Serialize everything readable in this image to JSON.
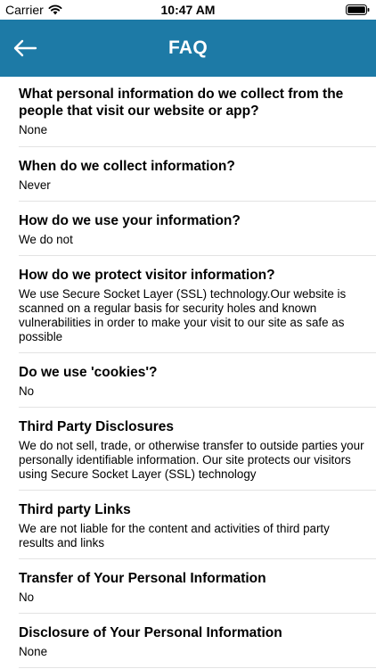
{
  "status_bar": {
    "carrier": "Carrier",
    "time": "10:47 AM"
  },
  "nav": {
    "title": "FAQ",
    "back_icon": "back-arrow-icon",
    "color": "#1d7aa6"
  },
  "faq": [
    {
      "question": "What personal information do we collect from the people that visit our website or app?",
      "answer": "None"
    },
    {
      "question": "When do we collect information?",
      "answer": "Never"
    },
    {
      "question": "How do we use your information?",
      "answer": "We do not"
    },
    {
      "question": "How do we protect visitor information?",
      "answer": "We use Secure Socket Layer (SSL) technology.Our website is scanned on a regular basis for security holes and known vulnerabilities in order to make your visit to our site as safe as possible"
    },
    {
      "question": "Do we use 'cookies'?",
      "answer": "No"
    },
    {
      "question": "Third Party Disclosures",
      "answer": "We do not sell, trade, or otherwise transfer to outside parties your personally identifiable information. Our site protects our visitors using Secure Socket Layer (SSL) technology"
    },
    {
      "question": "Third party Links",
      "answer": "We are not liable for the content and activities of third party results and links"
    },
    {
      "question": "Transfer of Your Personal Information",
      "answer": "No"
    },
    {
      "question": "Disclosure of Your Personal Information",
      "answer": "None"
    }
  ]
}
